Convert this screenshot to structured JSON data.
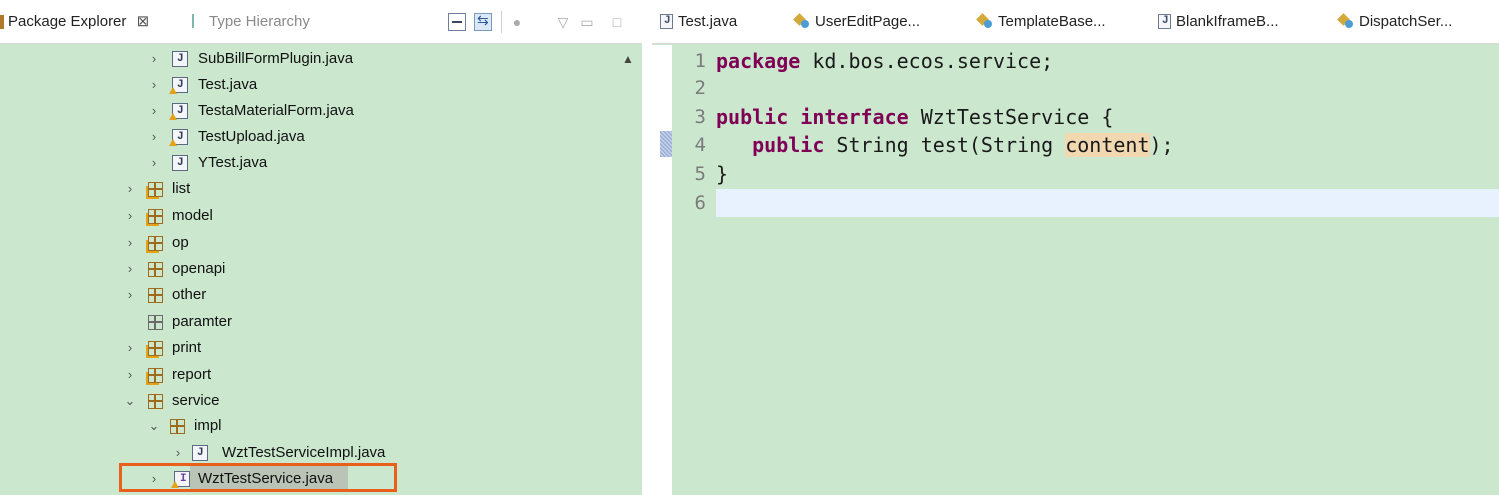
{
  "explorer": {
    "tab_package_explorer": "Package Explorer",
    "tab_close_symbol": "⊠",
    "tab_type_hierarchy": "Type Hierarchy",
    "items": [
      {
        "label": "SubBillFormPlugin.java",
        "type": "java",
        "arrow": "›"
      },
      {
        "label": "Test.java",
        "type": "java-warn",
        "arrow": "›"
      },
      {
        "label": "TestaMaterialForm.java",
        "type": "java-warn",
        "arrow": "›"
      },
      {
        "label": "TestUpload.java",
        "type": "java-warn",
        "arrow": "›"
      },
      {
        "label": "YTest.java",
        "type": "java",
        "arrow": "›"
      },
      {
        "label": "list",
        "type": "pkg-warn",
        "arrow": "›"
      },
      {
        "label": "model",
        "type": "pkg-warn",
        "arrow": "›"
      },
      {
        "label": "op",
        "type": "pkg-warn",
        "arrow": "›"
      },
      {
        "label": "openapi",
        "type": "pkg",
        "arrow": "›"
      },
      {
        "label": "other",
        "type": "pkg",
        "arrow": "›"
      },
      {
        "label": "paramter",
        "type": "pkg-empty",
        "arrow": ""
      },
      {
        "label": "print",
        "type": "pkg-warn",
        "arrow": "›"
      },
      {
        "label": "report",
        "type": "pkg-warn",
        "arrow": "›"
      },
      {
        "label": "service",
        "type": "pkg",
        "arrow": "⌄"
      },
      {
        "label": "impl",
        "type": "pkg",
        "arrow": "⌄"
      },
      {
        "label": "WztTestServiceImpl.java",
        "type": "java",
        "arrow": "›"
      },
      {
        "label": "WztTestService.java",
        "type": "iface",
        "arrow": "›"
      }
    ]
  },
  "editor": {
    "tabs": [
      {
        "label": "Test.java",
        "icon": "java-file-icon"
      },
      {
        "label": "UserEditPage...",
        "icon": "class-icon"
      },
      {
        "label": "TemplateBase...",
        "icon": "class-icon"
      },
      {
        "label": "BlankIframeB...",
        "icon": "java-file-icon"
      },
      {
        "label": "DispatchSer...",
        "icon": "class-icon"
      }
    ],
    "line_numbers": [
      "1",
      "2",
      "3",
      "4",
      "5",
      "6"
    ],
    "code": {
      "l1_kw": "package",
      "l1_rest": " kd.bos.ecos.service;",
      "l3_kw1": "public",
      "l3_sp": " ",
      "l3_kw2": "interface",
      "l3_rest": " WztTestService {",
      "l4_indent": "   ",
      "l4_kw": "public",
      "l4_mid": " String test(String ",
      "l4_param": "content",
      "l4_end": ");",
      "l5": "}"
    }
  },
  "colors": {
    "panel_bg": "#cbe8cf",
    "keyword": "#7f0055",
    "highlight_box": "#e8601c",
    "current_line": "#e8f2fe"
  }
}
